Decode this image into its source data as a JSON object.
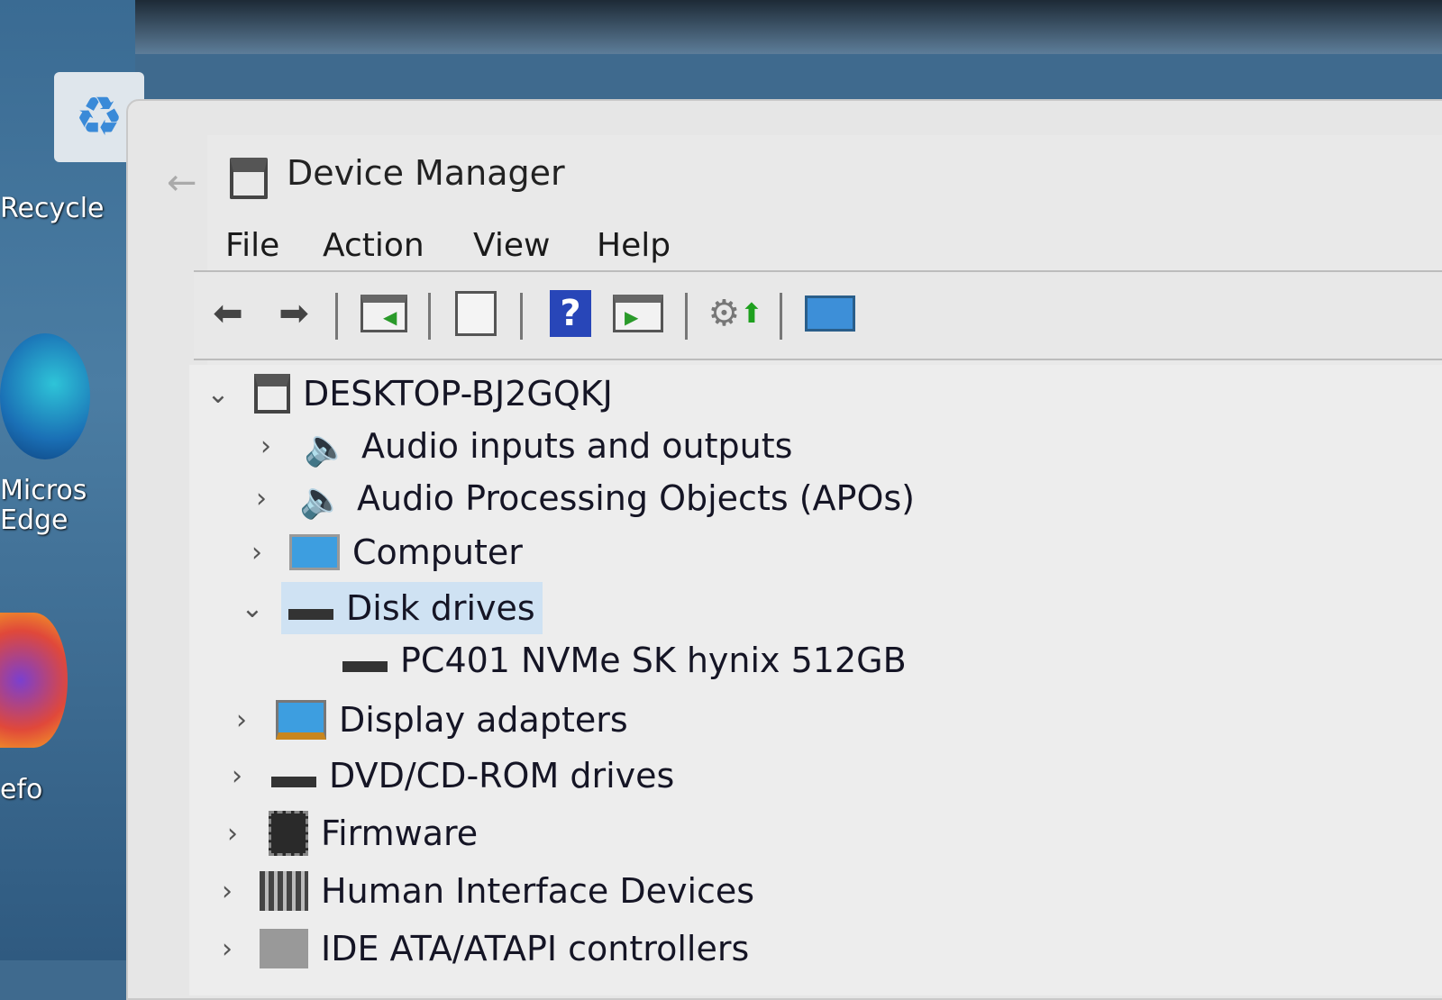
{
  "desktop": {
    "icons": [
      "Recycle",
      "Micros Edge",
      "efo"
    ]
  },
  "window": {
    "title": "Device Manager"
  },
  "menu": [
    "File",
    "Action",
    "View",
    "Help"
  ],
  "toolbar": [
    "back-icon",
    "forward-icon",
    "show-hide-console-tree-icon",
    "properties-icon",
    "help-icon",
    "show-action-pane-icon",
    "scan-hardware-changes-icon",
    "monitor-icon"
  ],
  "tree": {
    "root": "DESKTOP-BJ2GQKJ",
    "items": [
      {
        "label": "Audio inputs and outputs",
        "expanded": false
      },
      {
        "label": "Audio Processing Objects (APOs)",
        "expanded": false
      },
      {
        "label": "Computer",
        "expanded": false
      },
      {
        "label": "Disk drives",
        "expanded": true,
        "selected": true,
        "children": [
          "PC401 NVMe SK hynix 512GB"
        ]
      },
      {
        "label": "Display adapters",
        "expanded": false
      },
      {
        "label": "DVD/CD-ROM drives",
        "expanded": false
      },
      {
        "label": "Firmware",
        "expanded": false
      },
      {
        "label": "Human Interface Devices",
        "expanded": false
      },
      {
        "label": "IDE ATA/ATAPI controllers",
        "expanded": false
      }
    ]
  }
}
